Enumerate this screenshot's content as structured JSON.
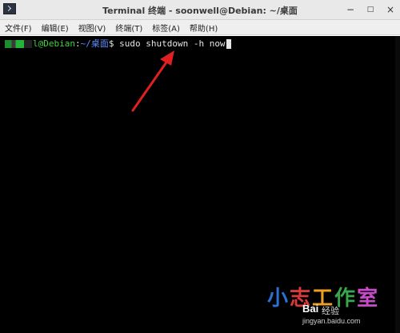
{
  "window": {
    "title": "Terminal 终端 - soonwell@Debian: ~/桌面",
    "icon": "terminal-icon",
    "buttons": {
      "minimize": "−",
      "maximize": "□",
      "close": "×"
    }
  },
  "menubar": {
    "items": [
      "文件(F)",
      "编辑(E)",
      "视图(V)",
      "终端(T)",
      "标签(A)",
      "帮助(H)"
    ]
  },
  "terminal": {
    "prompt_user_host": "l@Debian",
    "prompt_separator": ":",
    "prompt_path": "~/桌面",
    "prompt_symbol": "$",
    "command": " sudo shutdown -h now",
    "colors": {
      "background": "#000000",
      "user": "#3fd23f",
      "path": "#5c8cff",
      "text": "#e6e6e6"
    }
  },
  "annotation": {
    "arrow_color": "#e02020"
  },
  "watermark": {
    "chars": [
      "小",
      "志",
      "工",
      "作",
      "室"
    ],
    "baidu": "Bai",
    "jingyan": "经验",
    "url": "jingyan.baidu.com"
  }
}
